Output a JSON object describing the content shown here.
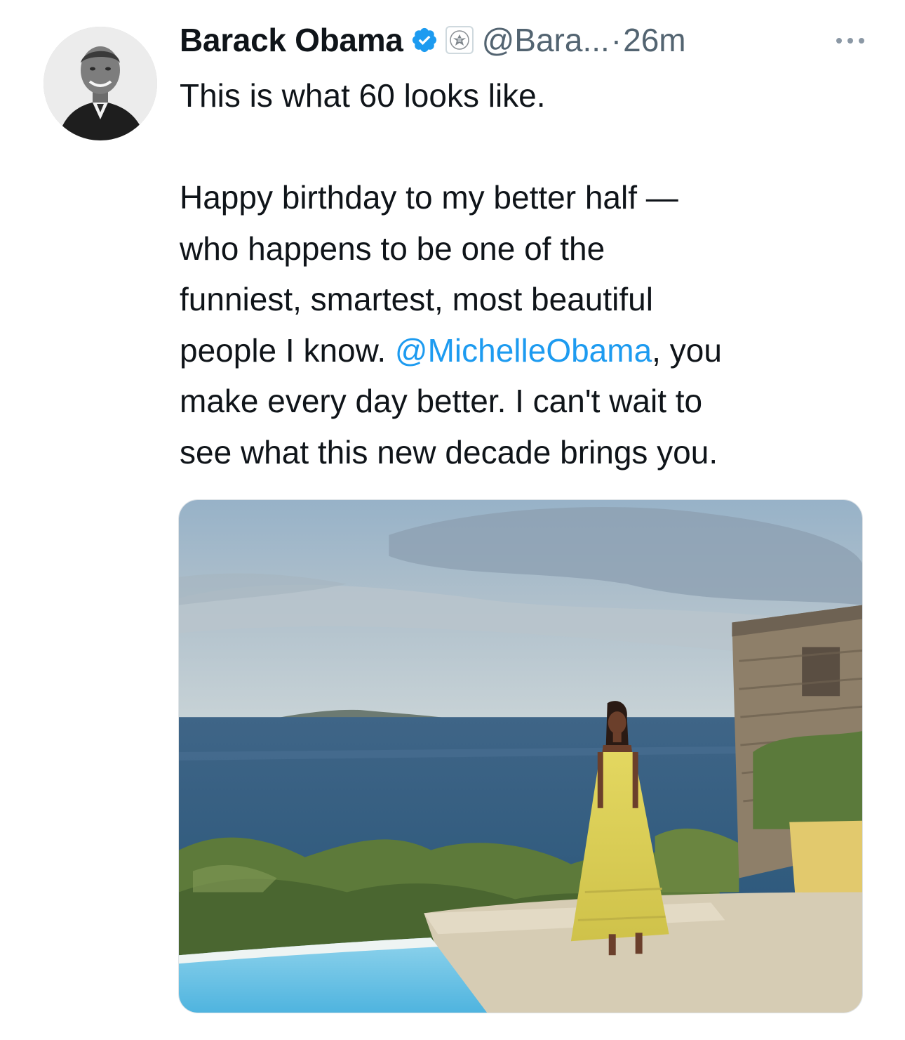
{
  "tweet": {
    "author": {
      "name": "Barack Obama",
      "handle": "@Bara...",
      "verified": true,
      "avatar_icon": "avatar-photo"
    },
    "separator": "·",
    "time": "26m",
    "more_icon": "ellipsis-icon",
    "text": {
      "line1": "This is what 60 looks like.",
      "line2": "Happy birthday to my better half —",
      "line3": "who happens to be one of the",
      "line4": "funniest, smartest, most beautiful",
      "line5_before": "people I know. ",
      "mention": "@MichelleObama",
      "line5_after": ", you",
      "line6": "make every day better. I can't wait to",
      "line7": "see what this new decade brings you."
    },
    "media": {
      "type": "photo"
    }
  },
  "colors": {
    "text": "#0f1419",
    "secondary": "#536471",
    "link": "#1d9bf0",
    "verified": "#1d9bf0"
  }
}
